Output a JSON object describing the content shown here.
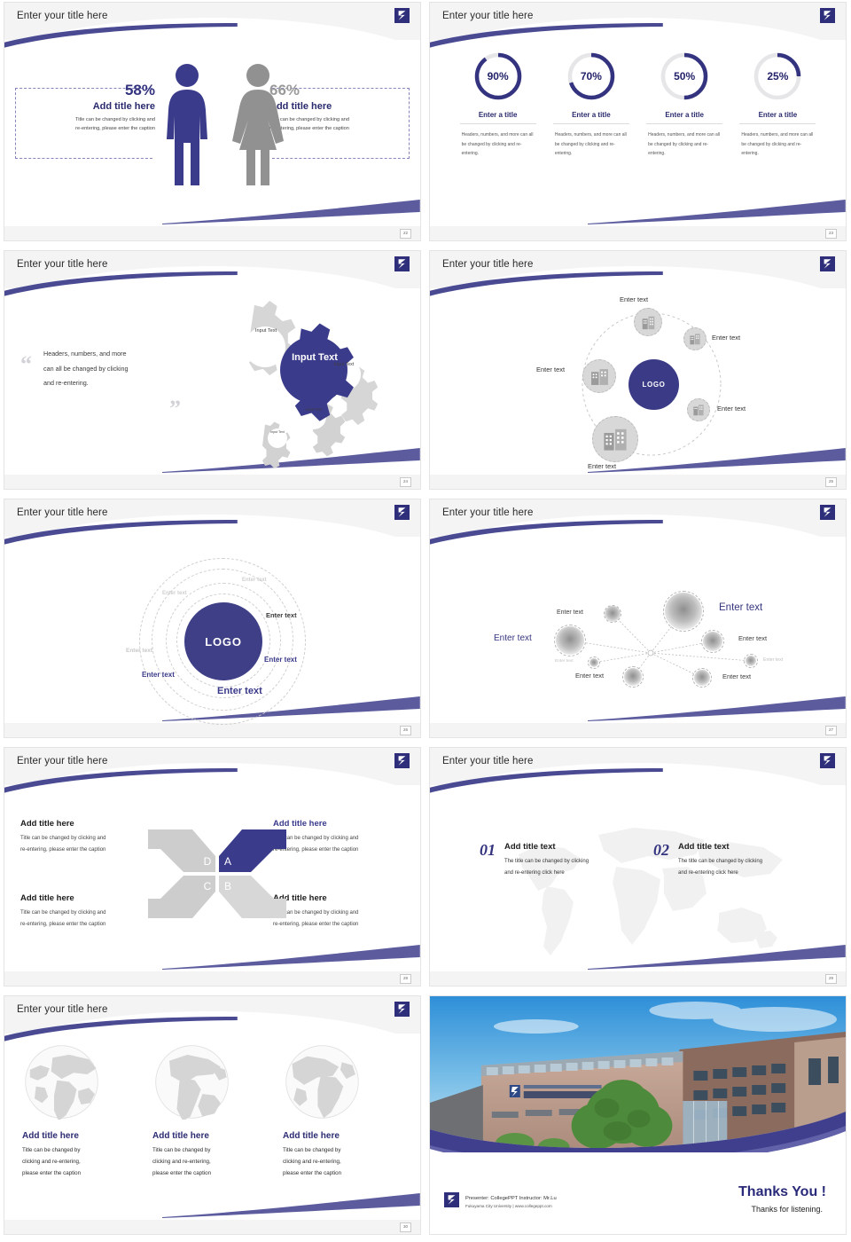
{
  "common": {
    "slide_title": "Enter your title here",
    "logo_name": "brand-logo",
    "accent_color": "#3b3b8c",
    "navy": "#33337f",
    "gray": "#9a9a9a"
  },
  "slides": [
    {
      "number": "22",
      "title": "Enter your title here",
      "type": "gender-percent",
      "left": {
        "percent": "58%",
        "title": "Add title here",
        "desc_line1": "Title can be changed by clicking and",
        "desc_line2": "re-entering, please enter the caption"
      },
      "right": {
        "percent": "66%",
        "title": "Add title here",
        "desc_line1": "Title can be changed by clicking and",
        "desc_line2": "re-entering, please enter the caption"
      }
    },
    {
      "number": "23",
      "title": "Enter your title here",
      "type": "donuts",
      "items": [
        {
          "value": 90,
          "label": "90%",
          "title": "Enter a title",
          "desc": "Headers, numbers, and more can all be changed by clicking and re-entering."
        },
        {
          "value": 70,
          "label": "70%",
          "title": "Enter a title",
          "desc": "Headers, numbers, and more can all be changed by clicking and re-entering."
        },
        {
          "value": 50,
          "label": "50%",
          "title": "Enter a title",
          "desc": "Headers, numbers, and more can all be changed by clicking and re-entering."
        },
        {
          "value": 25,
          "label": "25%",
          "title": "Enter a title",
          "desc": "Headers, numbers, and more can all be changed by clicking and re-entering."
        }
      ]
    },
    {
      "number": "24",
      "title": "Enter your title here",
      "type": "gears",
      "quote_line1": "Headers, numbers, and more",
      "quote_line2": "can all be changed by clicking",
      "quote_line3": "and re-entering.",
      "quote_open": "“",
      "quote_close": "”",
      "gears": [
        {
          "label": "Input Text",
          "size": "md"
        },
        {
          "label": "Input Text",
          "size": "lg-main"
        },
        {
          "label": "Input Text",
          "size": "md2"
        },
        {
          "label": "Input Text",
          "size": "sm"
        },
        {
          "label": "Input Text",
          "size": "xs"
        }
      ]
    },
    {
      "number": "25",
      "title": "Enter your title here",
      "type": "hub",
      "center": "LOGO",
      "nodes": [
        {
          "label": "Enter text",
          "pos": "top"
        },
        {
          "label": "Enter text",
          "pos": "right-up"
        },
        {
          "label": "Enter text",
          "pos": "right-down"
        },
        {
          "label": "Enter text",
          "pos": "bottom"
        },
        {
          "label": "Enter text",
          "pos": "left"
        }
      ]
    },
    {
      "number": "26",
      "title": "Enter your title here",
      "type": "concentric",
      "center": "LOGO",
      "labels": [
        {
          "label": "Enter text",
          "tone": "faint"
        },
        {
          "label": "Enter text",
          "tone": "faint"
        },
        {
          "label": "Enter text",
          "tone": "dark"
        },
        {
          "label": "Enter text",
          "tone": "navy"
        },
        {
          "label": "Enter text",
          "tone": "navy-lg"
        },
        {
          "label": "Enter text",
          "tone": "navy"
        },
        {
          "label": "Enter text",
          "tone": "faint"
        }
      ]
    },
    {
      "number": "27",
      "title": "Enter your title here",
      "type": "network",
      "labels": [
        {
          "label": "Enter text",
          "tone": "dark-sm"
        },
        {
          "label": "Enter text",
          "tone": "navy-lg"
        },
        {
          "label": "Enter text",
          "tone": "navy-md"
        },
        {
          "label": "Enter text",
          "tone": "dark-sm"
        },
        {
          "label": "Enter text",
          "tone": "faint"
        },
        {
          "label": "Enter text",
          "tone": "faint-xs"
        },
        {
          "label": "Enter text",
          "tone": "dark-sm"
        },
        {
          "label": "Enter text",
          "tone": "dark-sm"
        }
      ]
    },
    {
      "number": "28",
      "title": "Enter your title here",
      "type": "x-quadrant",
      "quadrants": [
        {
          "key": "D",
          "title": "Add title here",
          "desc_line1": "Title can be changed by clicking and",
          "desc_line2": "re-entering, please enter the caption",
          "accent": false
        },
        {
          "key": "A",
          "title": "Add title here",
          "desc_line1": "Title can be changed by clicking and",
          "desc_line2": "re-entering, please enter the caption",
          "accent": true
        },
        {
          "key": "C",
          "title": "Add title here",
          "desc_line1": "Title can be changed by clicking and",
          "desc_line2": "re-entering, please enter the caption",
          "accent": false
        },
        {
          "key": "B",
          "title": "Add title here",
          "desc_line1": "Title can be changed by clicking and",
          "desc_line2": "re-entering, please enter the caption",
          "accent": false
        }
      ]
    },
    {
      "number": "29",
      "title": "Enter your title here",
      "type": "numbered-world",
      "items": [
        {
          "num": "01",
          "title": "Add title text",
          "desc_line1": "The title can be changed by clicking",
          "desc_line2": "and re-entering click here"
        },
        {
          "num": "02",
          "title": "Add title text",
          "desc_line1": "The title can be changed by clicking",
          "desc_line2": "and re-entering click here"
        }
      ]
    },
    {
      "number": "30",
      "title": "Enter your title here",
      "type": "globes",
      "items": [
        {
          "title": "Add title here",
          "desc_line1": "Title can be changed by",
          "desc_line2": "clicking and re-entering,",
          "desc_line3": "please enter the caption"
        },
        {
          "title": "Add title here",
          "desc_line1": "Title can be changed by",
          "desc_line2": "clicking and re-entering,",
          "desc_line3": "please enter the caption"
        },
        {
          "title": "Add title here",
          "desc_line1": "Title can be changed by",
          "desc_line2": "clicking and re-entering,",
          "desc_line3": "please enter the caption"
        }
      ]
    },
    {
      "number": "",
      "type": "thanks",
      "building_sign_en": "FUKUYAMA CITY UNIVERSITY",
      "building_sign_jp": "福山市立大学",
      "presenter_line": "Presenter: CollegePPT   Instructor: Mr.Lu",
      "org_line": "Fukuyama City University | www.collegeppt.com",
      "thanks_big": "Thanks You !",
      "thanks_small": "Thanks for listening."
    }
  ]
}
